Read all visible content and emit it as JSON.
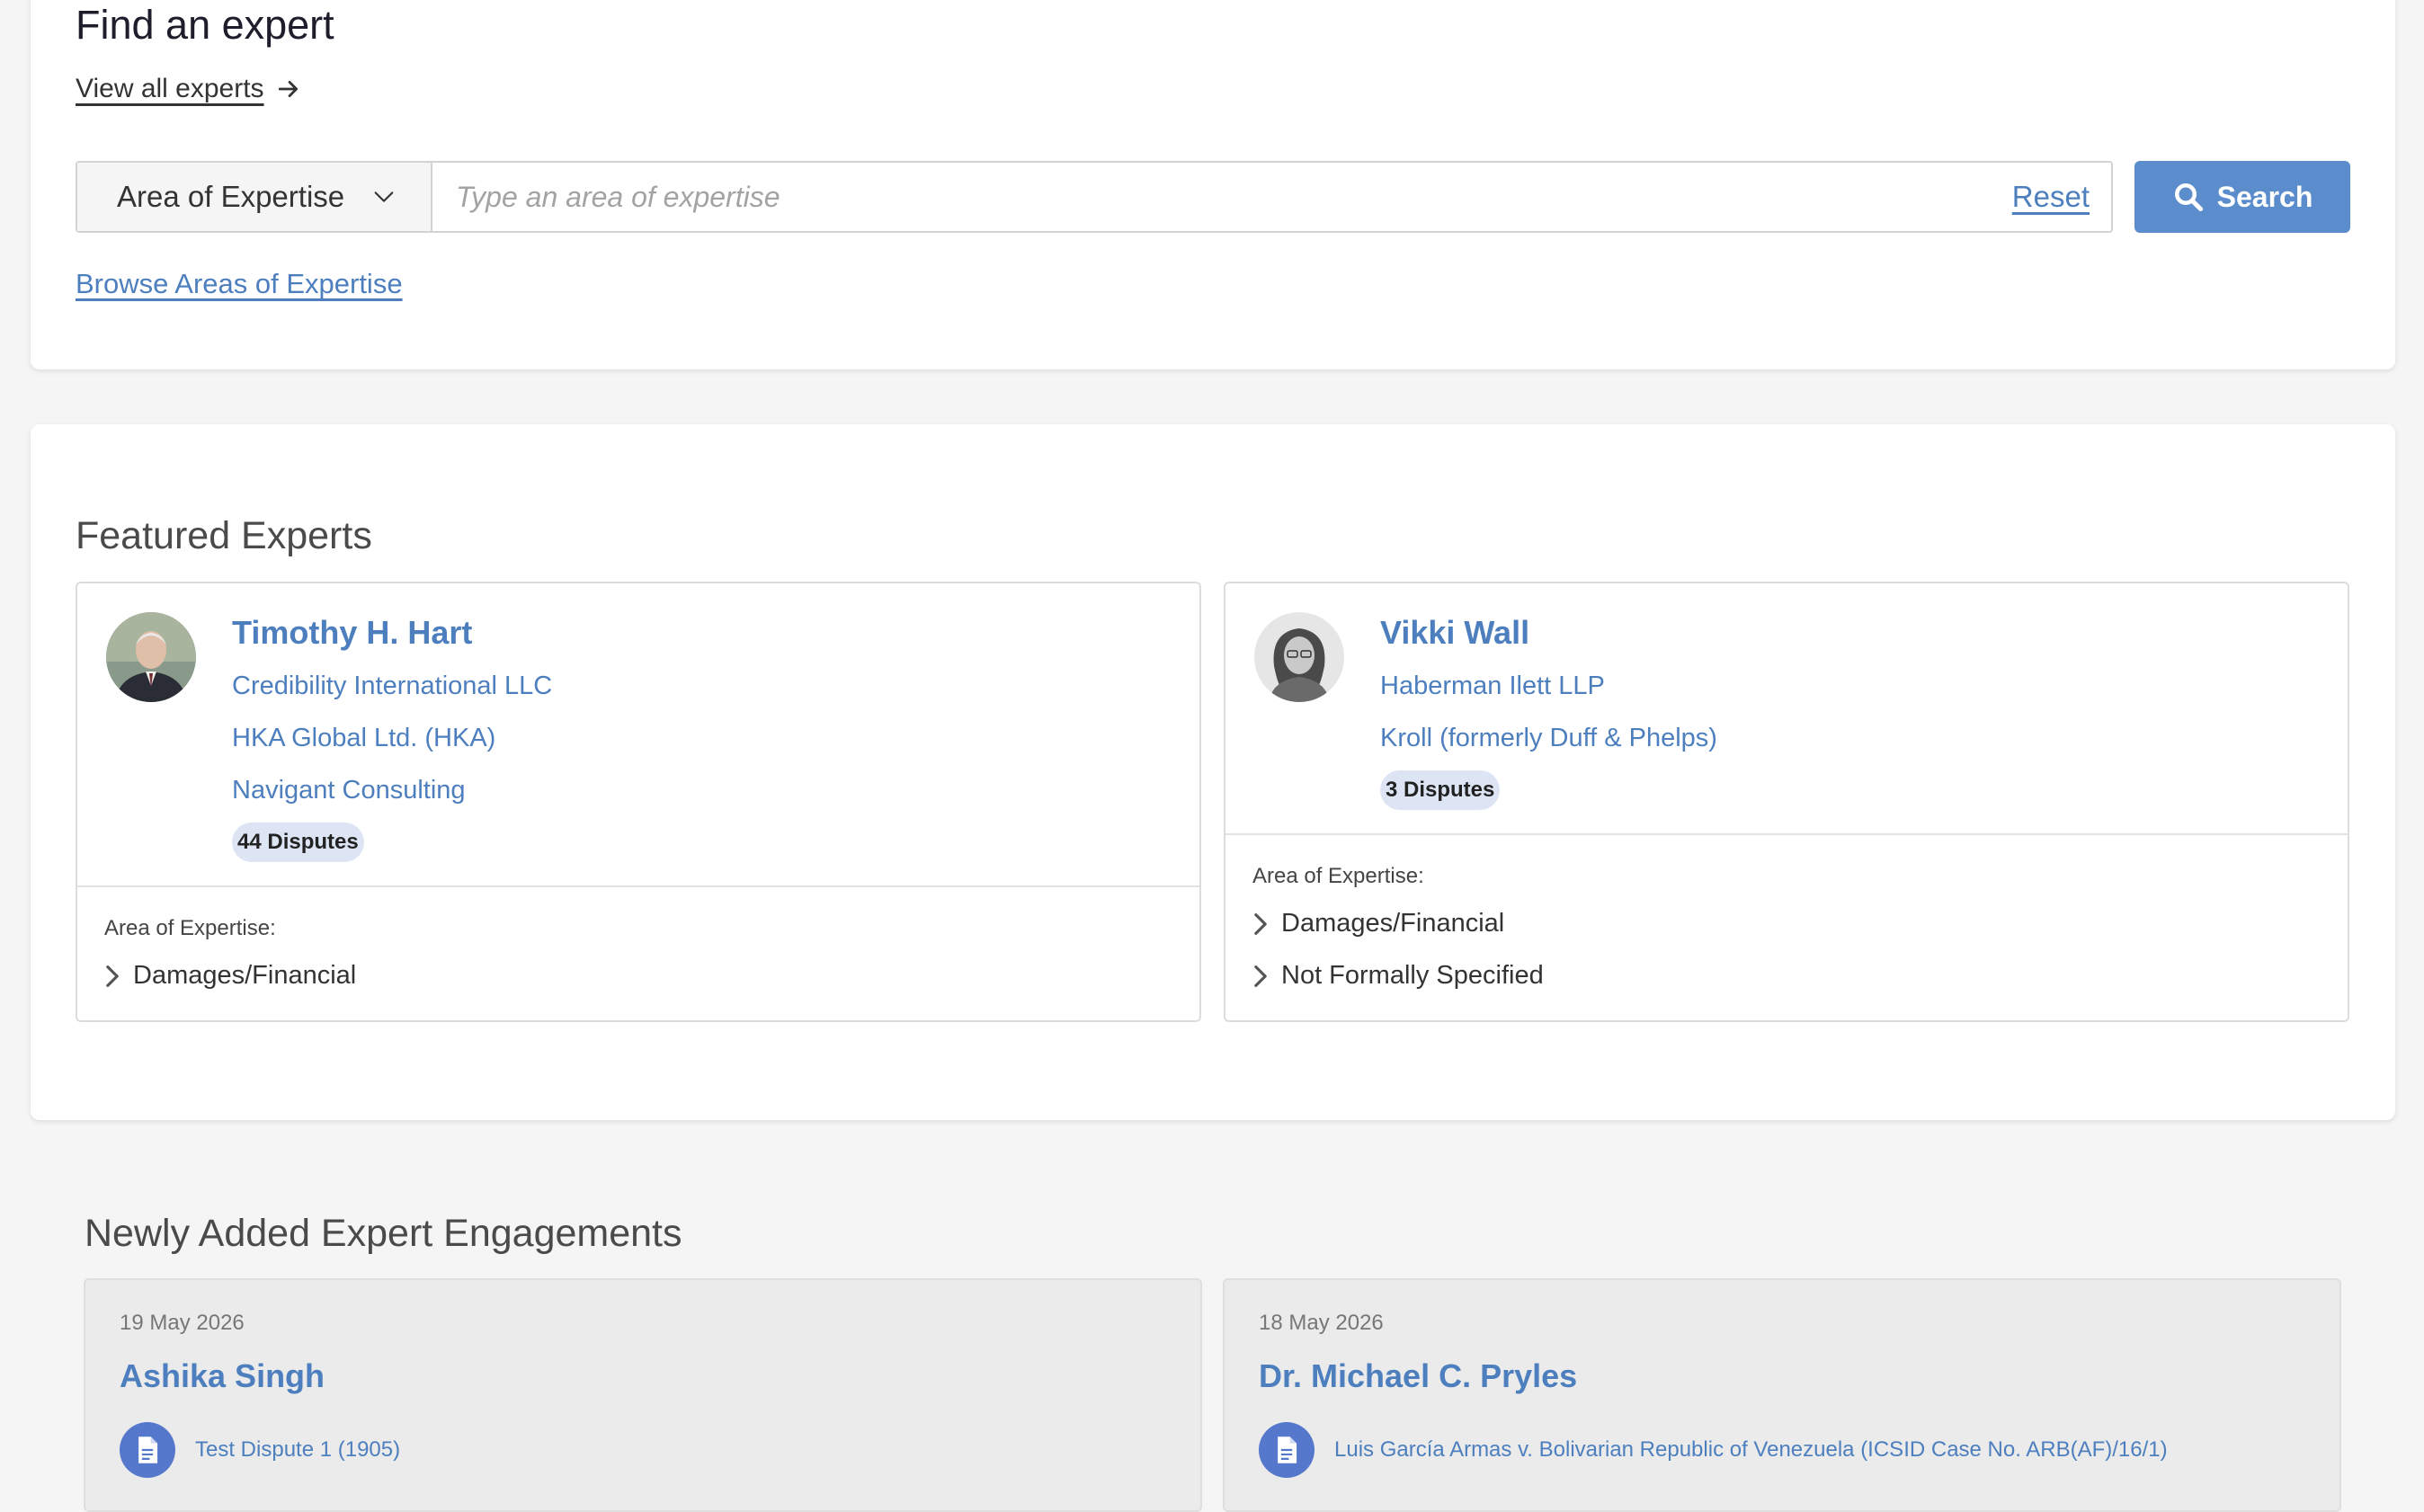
{
  "find": {
    "title": "Find an expert",
    "view_all": "View all experts",
    "area_select": "Area of Expertise",
    "search_placeholder": "Type an area of expertise",
    "reset": "Reset",
    "search_button": "Search",
    "browse": "Browse Areas of Expertise"
  },
  "featured": {
    "title": "Featured Experts",
    "aoe_label": "Area of Expertise:",
    "experts": [
      {
        "name": "Timothy H. Hart",
        "firms": [
          "Credibility International LLC",
          "HKA Global Ltd. (HKA)",
          "Navigant Consulting"
        ],
        "disputes": "44 Disputes",
        "areas": [
          "Damages/Financial"
        ]
      },
      {
        "name": "Vikki Wall",
        "firms": [
          "Haberman Ilett LLP",
          "Kroll (formerly Duff & Phelps)"
        ],
        "disputes": "3 Disputes",
        "areas": [
          "Damages/Financial",
          "Not Formally Specified"
        ]
      }
    ]
  },
  "engagements": {
    "title": "Newly Added Expert Engagements",
    "items": [
      {
        "date": "19 May 2026",
        "name": "Ashika Singh",
        "dispute": "Test Dispute 1 (1905)"
      },
      {
        "date": "18 May 2026",
        "name": "Dr. Michael C. Pryles",
        "dispute": "Luis García Armas v. Bolivarian Republic of Venezuela (ICSID Case No. ARB(AF)/16/1)"
      }
    ]
  },
  "colors": {
    "link": "#4d7fbf",
    "button": "#5b8ccc",
    "badge_bg": "#dde5f5",
    "doc_icon_bg": "#5577cc"
  }
}
